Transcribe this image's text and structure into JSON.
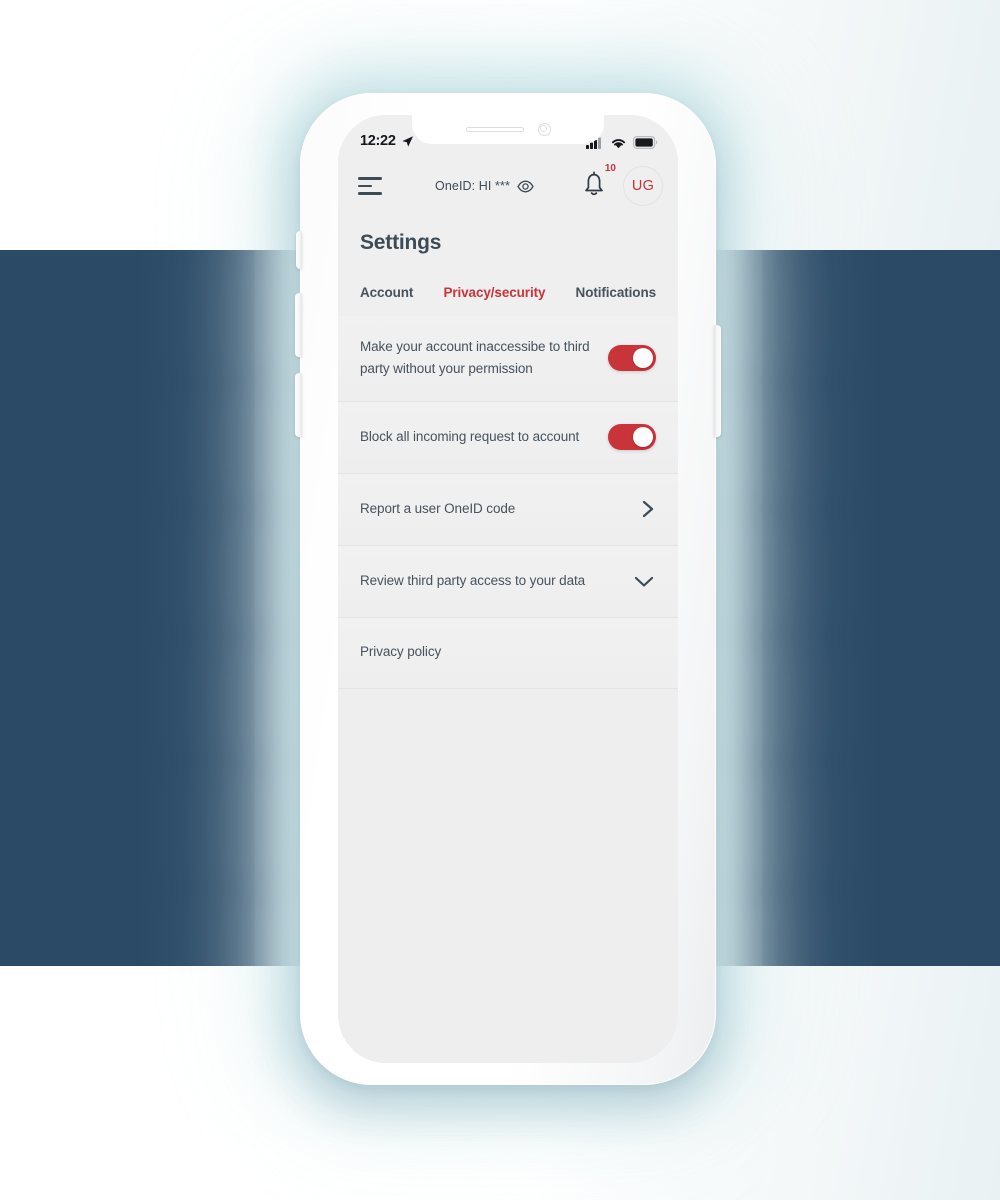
{
  "theme": {
    "accent_red": "#c9333a",
    "band_dark_blue": "#2a4a66",
    "screen_bg": "#eeeeee",
    "text_slate": "#46525e"
  },
  "status_bar": {
    "time": "12:22",
    "location_icon": "location-arrow-icon",
    "signal_icon": "cellular-signal-icon",
    "wifi_icon": "wifi-icon",
    "battery_icon": "battery-full-icon"
  },
  "app_header": {
    "menu_icon": "hamburger-menu-icon",
    "oneid_label": "OneID: HI ***",
    "eye_icon": "eye-icon",
    "bell_icon": "bell-icon",
    "notification_count": "10",
    "avatar_initials": "UG"
  },
  "page": {
    "title": "Settings"
  },
  "tabs": [
    {
      "label": "Account",
      "active": false
    },
    {
      "label": "Privacy/security",
      "active": true
    },
    {
      "label": "Notifications",
      "active": false
    }
  ],
  "settings_rows": [
    {
      "label": "Make your account inaccessibe to third party without your permission",
      "control": "toggle",
      "toggle_state": "on"
    },
    {
      "label": "Block all incoming request to account",
      "control": "toggle",
      "toggle_state": "on"
    },
    {
      "label": "Report a user OneID code",
      "control": "chevron-right",
      "toggle_state": ""
    },
    {
      "label": "Review third party access to your data",
      "control": "chevron-down",
      "toggle_state": ""
    },
    {
      "label": "Privacy policy",
      "control": "none",
      "toggle_state": ""
    }
  ]
}
